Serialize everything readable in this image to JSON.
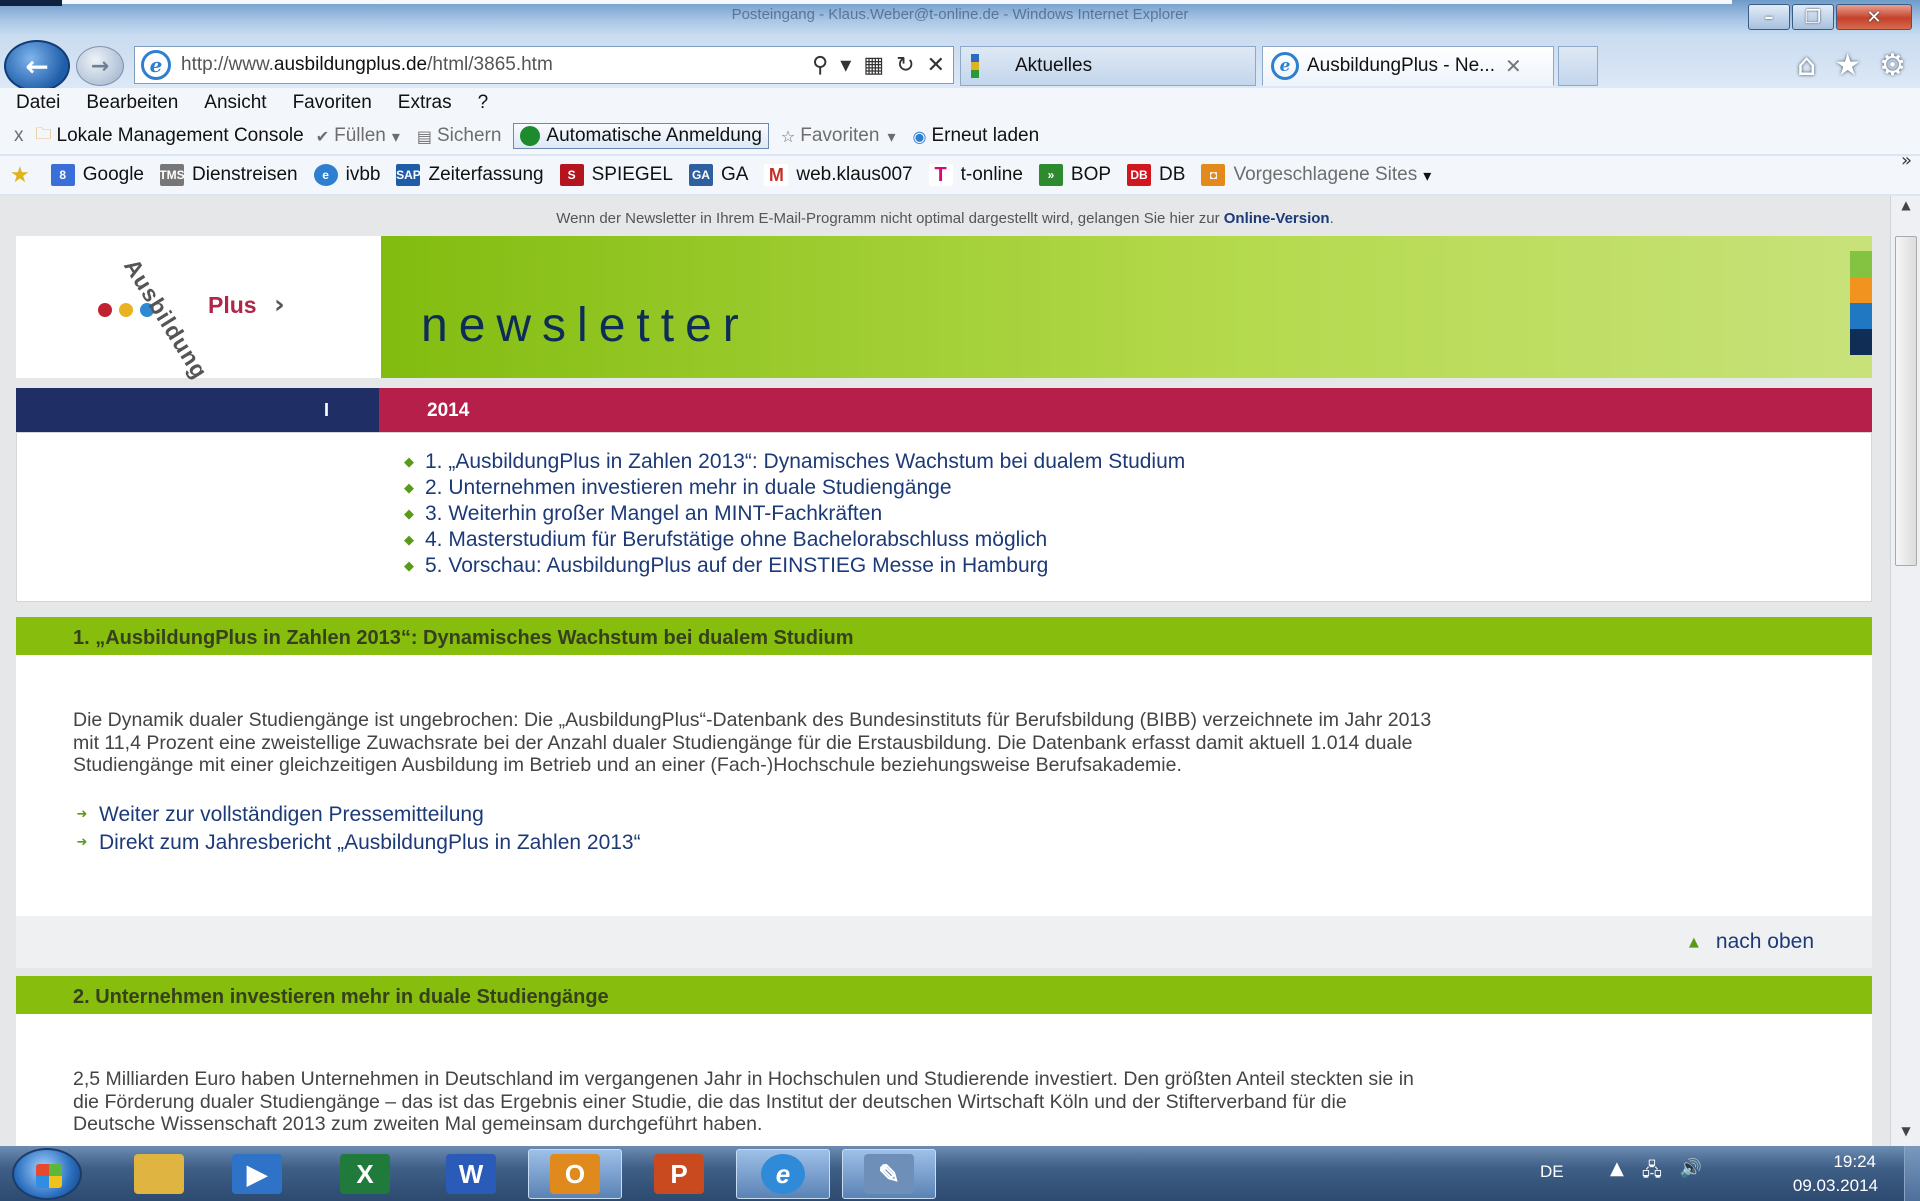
{
  "window": {
    "title": "Posteingang - Klaus.Weber@t-online.de - Windows Internet Explorer"
  },
  "nav": {
    "url_prefix": "http://www.",
    "url_domain": "ausbildungplus.de",
    "url_path": "/html/3865.htm",
    "tabs": [
      {
        "label": "Aktuelles"
      },
      {
        "label": "AusbildungPlus - Ne..."
      }
    ]
  },
  "menu": [
    "Datei",
    "Bearbeiten",
    "Ansicht",
    "Favoriten",
    "Extras",
    "?"
  ],
  "commandbar": {
    "close": "x",
    "console": "Lokale Management Console",
    "fill": "Füllen",
    "save": "Sichern",
    "autologin": "Automatische Anmeldung",
    "favorites": "Favoriten",
    "reload": "Erneut laden"
  },
  "favorites_bar": [
    {
      "label": "Google",
      "icon": "google-icon",
      "color": "#3b6fd8"
    },
    {
      "label": "Dienstreisen",
      "icon": "tms-icon",
      "color": "#555555"
    },
    {
      "label": "ivbb",
      "icon": "ie-page-icon",
      "color": "#2f7fd0"
    },
    {
      "label": "Zeiterfassung",
      "icon": "sap-icon",
      "color": "#1f5ca8"
    },
    {
      "label": "SPIEGEL",
      "icon": "spiegel-icon",
      "color": "#b3141d"
    },
    {
      "label": "GA",
      "icon": "ga-icon",
      "color": "#2e5f9e"
    },
    {
      "label": "web.klaus007",
      "icon": "mail-icon",
      "color": "#c4302b"
    },
    {
      "label": "t-online",
      "icon": "telekom-icon",
      "color": "#d20b76"
    },
    {
      "label": "BOP",
      "icon": "bop-icon",
      "color": "#2d8a2e"
    },
    {
      "label": "DB",
      "icon": "db-icon",
      "color": "#d2161e"
    },
    {
      "label": "Vorgeschlagene Sites",
      "icon": "suggested-sites-icon",
      "color": "#e28b1c"
    }
  ],
  "page": {
    "hint_text": "Wenn der Newsletter in Ihrem E-Mail-Programm nicht optimal dargestellt wird, gelangen Sie hier zur",
    "hint_link": "Online-Version",
    "hint_end": ".",
    "logo_word": "Ausbildung",
    "logo_plus": "Plus",
    "banner_word": "newsletter",
    "issue_number": "I",
    "issue_year": "2014",
    "toc": [
      "1. „AusbildungPlus in Zahlen 2013“: Dynamisches Wachstum bei dualem Studium",
      "2. Unternehmen investieren mehr in duale Studiengänge",
      "3. Weiterhin großer Mangel an MINT-Fachkräften",
      "4. Masterstudium für Berufstätige ohne Bachelorabschluss möglich",
      "5. Vorschau: AusbildungPlus auf der EINSTIEG Messe in Hamburg"
    ],
    "sections": [
      {
        "heading": "1. „AusbildungPlus in Zahlen 2013“: Dynamisches Wachstum bei dualem Studium",
        "paragraph_lines": [
          "Die Dynamik dualer Studiengänge ist ungebrochen: Die „AusbildungPlus“-Datenbank des Bundesinstituts für Berufsbildung (BIBB) verzeichnete im Jahr 2013",
          "mit 11,4 Prozent eine zweistellige Zuwachsrate bei der Anzahl dualer Studiengänge für die Erstausbildung. Die Datenbank erfasst damit aktuell 1.014 duale",
          "Studiengänge mit einer gleichzeitigen Ausbildung im Betrieb und an einer (Fach-)Hochschule beziehungsweise Berufsakademie."
        ],
        "links": [
          "Weiter zur vollständigen Pressemitteilung",
          "Direkt zum Jahresbericht „AusbildungPlus in Zahlen 2013“"
        ]
      },
      {
        "heading": "2. Unternehmen investieren mehr in duale Studiengänge",
        "paragraph_lines": [
          "2,5 Milliarden Euro haben Unternehmen in Deutschland im vergangenen Jahr in Hochschulen und Studierende investiert. Den größten Anteil steckten sie in",
          "die Förderung dualer Studiengänge – das ist das Ergebnis einer Studie, die das Institut der deutschen Wirtschaft Köln und der Stifterverband für die",
          "Deutsche Wissenschaft 2013 zum zweiten Mal gemeinsam durchgeführt haben."
        ]
      }
    ],
    "back_to_top": "nach oben"
  },
  "taskbar": {
    "apps": [
      {
        "icon": "explorer-icon",
        "color": "#e0b440"
      },
      {
        "icon": "media-player-icon",
        "color": "#2f73c9"
      },
      {
        "icon": "excel-icon",
        "color": "#1f7a3c",
        "glyph": "X"
      },
      {
        "icon": "word-icon",
        "color": "#2a5bb8",
        "glyph": "W"
      },
      {
        "icon": "outlook-icon",
        "color": "#e08a1e",
        "glyph": "O"
      },
      {
        "icon": "powerpoint-icon",
        "color": "#c94a1f",
        "glyph": "P"
      },
      {
        "icon": "ie-icon",
        "color": "#2f8ad8",
        "glyph": "e"
      },
      {
        "icon": "paint-icon",
        "color": "#6d8fb8"
      }
    ],
    "language": "DE",
    "time": "19:24",
    "date": "09.03.2014"
  },
  "colors": {
    "banner_green": "#87bd0c",
    "issue_navy": "#1f2f66",
    "issue_red": "#b51f49",
    "link_blue": "#1d3a78",
    "stripes": [
      "#84c341",
      "#f0941f",
      "#1f78c1",
      "#0f2d55"
    ],
    "logo_dots": [
      "#c0232f",
      "#e9b21f",
      "#2d8ad0"
    ]
  }
}
